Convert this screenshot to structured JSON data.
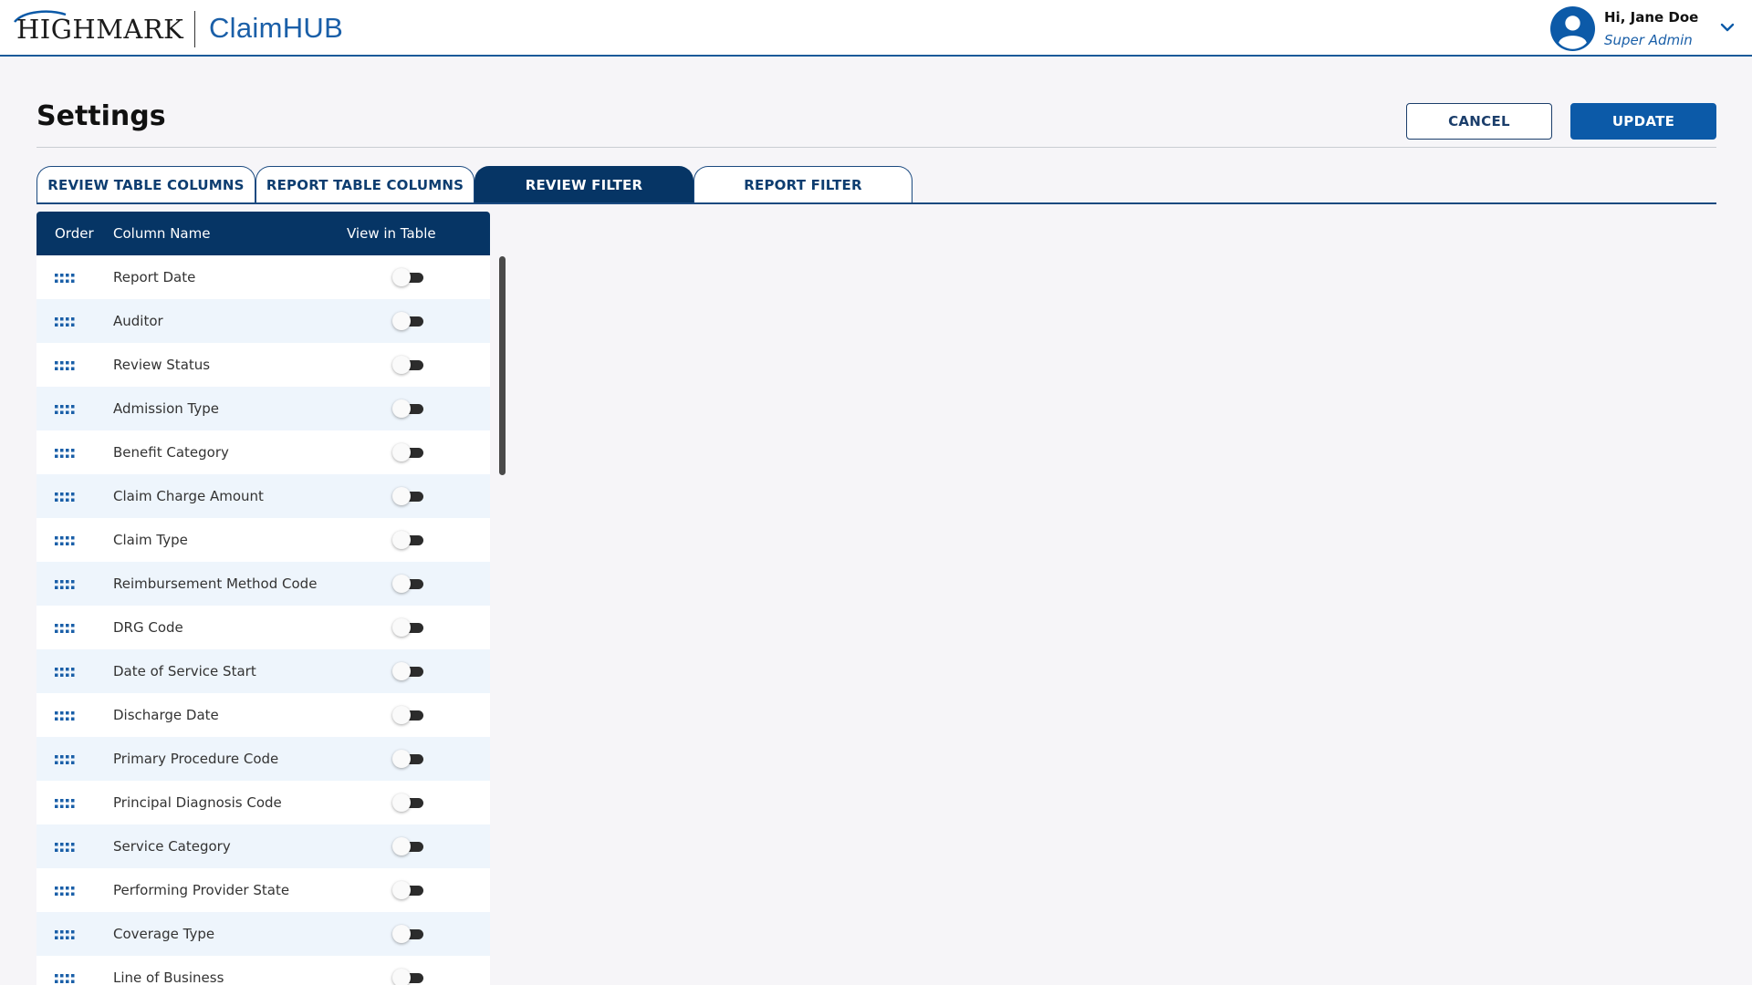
{
  "header": {
    "brand": "HIGHMARK",
    "app_name": "ClaimHUB",
    "user_greeting": "Hi, Jane Doe",
    "user_role": "Super Admin"
  },
  "page": {
    "title": "Settings",
    "cancel_label": "CANCEL",
    "update_label": "UPDATE"
  },
  "tabs": [
    {
      "label": "REVIEW TABLE COLUMNS",
      "active": false
    },
    {
      "label": "REPORT TABLE COLUMNS",
      "active": false
    },
    {
      "label": "REVIEW FILTER",
      "active": true
    },
    {
      "label": "REPORT FILTER",
      "active": false
    }
  ],
  "table": {
    "headers": {
      "order": "Order",
      "column_name": "Column Name",
      "view_in_table": "View in Table"
    },
    "rows": [
      {
        "label": "Report Date",
        "on": false
      },
      {
        "label": "Auditor",
        "on": false
      },
      {
        "label": "Review Status",
        "on": false
      },
      {
        "label": "Admission Type",
        "on": false
      },
      {
        "label": "Benefit Category",
        "on": false
      },
      {
        "label": "Claim Charge Amount",
        "on": false
      },
      {
        "label": "Claim Type",
        "on": false
      },
      {
        "label": "Reimbursement Method Code",
        "on": false
      },
      {
        "label": "DRG Code",
        "on": false
      },
      {
        "label": "Date of Service Start",
        "on": false
      },
      {
        "label": "Discharge Date",
        "on": false
      },
      {
        "label": "Primary Procedure Code",
        "on": false
      },
      {
        "label": "Principal Diagnosis Code",
        "on": false
      },
      {
        "label": "Service Category",
        "on": false
      },
      {
        "label": "Performing Provider State",
        "on": false
      },
      {
        "label": "Coverage Type",
        "on": false
      },
      {
        "label": "Line of Business",
        "on": false
      }
    ]
  },
  "colors": {
    "navy": "#063565",
    "brand_blue": "#0c5aa8",
    "row_alt": "#eef5fc"
  },
  "icons": {
    "avatar": "user-circle-icon",
    "chevron": "chevron-down-icon",
    "drag": "drag-handle-icon"
  }
}
